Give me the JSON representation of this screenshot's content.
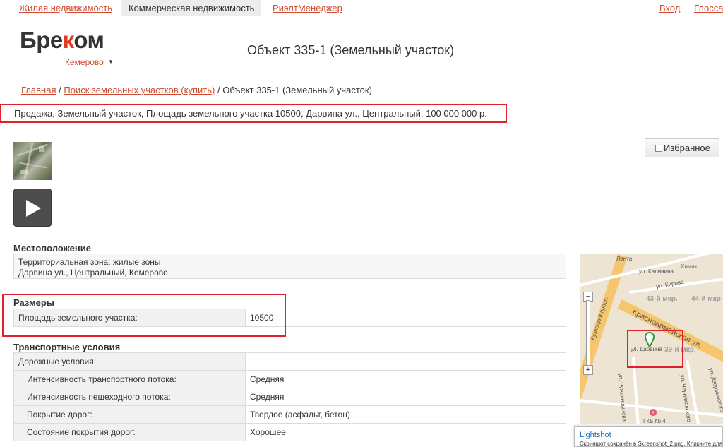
{
  "topnav": {
    "residential": "Жилая недвижимость",
    "commercial": "Коммерческая недвижимость",
    "realtmanager": "РиэлтМенеджер",
    "login": "Вход",
    "glossary": "Глоссар"
  },
  "logo": {
    "part1": "Бре",
    "part2": "к",
    "part3": "ом"
  },
  "city": "Кемерово",
  "page_title": "Объект 335-1 (Земельный участок)",
  "breadcrumb": {
    "home": "Главная",
    "search": "Поиск земельных участков (купить)",
    "current": "Объект 335-1 (Земельный участок)",
    "separator": "/"
  },
  "summary": "Продажа, Земельный участок, Площадь земельного участка 10500, Дарвина ул., Центральный, 100 000 000 р.",
  "favorite_label": "Избранное",
  "location": {
    "heading": "Местоположение",
    "line1": "Территориальная зона: жилые зоны",
    "line2": "Дарвина ул., Центральный, Кемерово"
  },
  "sizes": {
    "heading": "Размеры",
    "rows": [
      {
        "key": "Площадь земельного участка:",
        "value": "10500"
      }
    ]
  },
  "transport": {
    "heading": "Транспортные условия",
    "rows": [
      {
        "key": "Дорожные условия:",
        "value": ""
      },
      {
        "key": "Интенсивность транспортного потока:",
        "value": "Средняя"
      },
      {
        "key": "Интенсивность пешеходного потока:",
        "value": "Средняя"
      },
      {
        "key": "Покрытие дорог:",
        "value": "Твердое (асфальт, бетон)"
      },
      {
        "key": "Состояние покрытия дорог:",
        "value": "Хорошее"
      }
    ]
  },
  "map": {
    "labels": {
      "lenta": "Лента",
      "khimik": "Химик",
      "kalinina": "ул. Калинина",
      "kirova": "ул. Кирова",
      "kuznetsky": "Кузнецкий просп.",
      "krasnoarmeyskaya": "Красноармейская ул.",
      "darvina": "ул. Дарвина",
      "mkr43": "43-й мкр.",
      "mkr44": "44-й мкр",
      "mkr39": "39-й мкр.",
      "dzerzhinsky": "ул. Дзержинского",
      "chernyakhovsky": "ул. Черняховского",
      "ruzhanitsynovo": "ул. Ружаницынова",
      "gkb": "ГКБ № 4"
    }
  },
  "lightshot": {
    "title": "Lightshot",
    "message": "Скриншот сохранён в Screenshot_2.png. Кликните для"
  },
  "colors": {
    "accent": "#d04a2f",
    "logo_k": "#e03a1e",
    "highlight": "#e0202a"
  }
}
